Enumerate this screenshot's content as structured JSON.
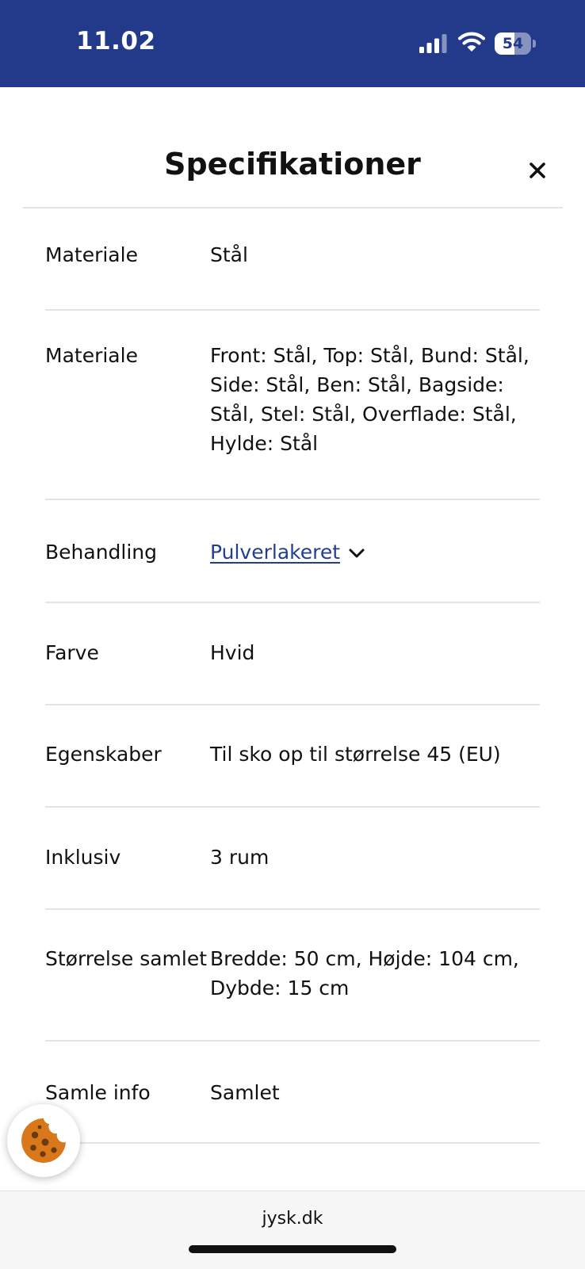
{
  "status_bar": {
    "time": "11.02",
    "battery_level": "54",
    "colors": {
      "background": "#233a8b"
    }
  },
  "modal": {
    "title": "Specifikationer",
    "close_icon": "close-icon"
  },
  "specs": [
    {
      "label": "Materiale",
      "value": "Stål"
    },
    {
      "label": "Materiale",
      "value": "Front: Stål, Top: Stål, Bund: Stål, Side: Stål, Ben: Stål, Bagside: Stål, Stel: Stål, Overflade: Stål, Hylde: Stål"
    },
    {
      "label": "Behandling",
      "value": "Pulverlakeret",
      "is_link": true,
      "icon": "chevron-down-icon"
    },
    {
      "label": "Farve",
      "value": "Hvid"
    },
    {
      "label": "Egenskaber",
      "value": "Til sko op til størrelse 45 (EU)"
    },
    {
      "label": "Inklusiv",
      "value": "3 rum"
    },
    {
      "label": "Størrelse samlet",
      "value": "Bredde: 50 cm, Højde: 104 cm, Dybde: 15 cm"
    },
    {
      "label": "Samle info",
      "value": "Samlet"
    }
  ],
  "cookie": {
    "icon": "cookie-icon"
  },
  "browser": {
    "url": "jysk.dk"
  },
  "colors": {
    "link": "#223e8f",
    "divider": "#e2e4e8"
  }
}
